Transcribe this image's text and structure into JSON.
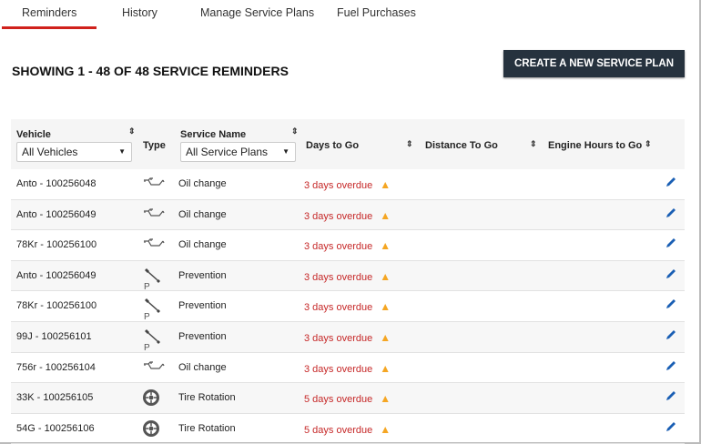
{
  "tabs": [
    {
      "label": "Reminders",
      "active": true
    },
    {
      "label": "History"
    },
    {
      "label": "Manage Service Plans"
    },
    {
      "label": "Fuel Purchases"
    }
  ],
  "heading": "SHOWING 1 - 48 OF 48 SERVICE REMINDERS",
  "create_button": "CREATE A NEW SERVICE PLAN",
  "columns": {
    "vehicle": "Vehicle",
    "type": "Type",
    "service_name": "Service Name",
    "days": "Days to Go",
    "distance": "Distance To Go",
    "engine_hours": "Engine Hours to Go"
  },
  "filters": {
    "vehicle": "All Vehicles",
    "service": "All Service Plans"
  },
  "rows": [
    {
      "vehicle": "Anto - 100256048",
      "type": "oil-can-icon",
      "service": "Oil change",
      "days": "3 days overdue"
    },
    {
      "vehicle": "Anto - 100256049",
      "type": "oil-can-icon",
      "service": "Oil change",
      "days": "3 days overdue"
    },
    {
      "vehicle": "78Kr - 100256100",
      "type": "oil-can-icon",
      "service": "Oil change",
      "days": "3 days overdue"
    },
    {
      "vehicle": "Anto - 100256049",
      "type": "wrench-p-icon",
      "service": "Prevention",
      "days": "3 days overdue"
    },
    {
      "vehicle": "78Kr - 100256100",
      "type": "wrench-p-icon",
      "service": "Prevention",
      "days": "3 days overdue"
    },
    {
      "vehicle": "99J - 100256101",
      "type": "wrench-p-icon",
      "service": "Prevention",
      "days": "3 days overdue"
    },
    {
      "vehicle": "756r - 100256104",
      "type": "oil-can-icon",
      "service": "Oil change",
      "days": "3 days overdue"
    },
    {
      "vehicle": "33K - 100256105",
      "type": "tire-icon",
      "service": "Tire Rotation",
      "days": "5 days overdue"
    },
    {
      "vehicle": "54G - 100256106",
      "type": "tire-icon",
      "service": "Tire Rotation",
      "days": "5 days overdue"
    }
  ],
  "colors": {
    "accent": "#d0211c",
    "button": "#26323e",
    "overdue": "#c62828",
    "warning": "#f5a623",
    "edit": "#1a5fb4"
  }
}
